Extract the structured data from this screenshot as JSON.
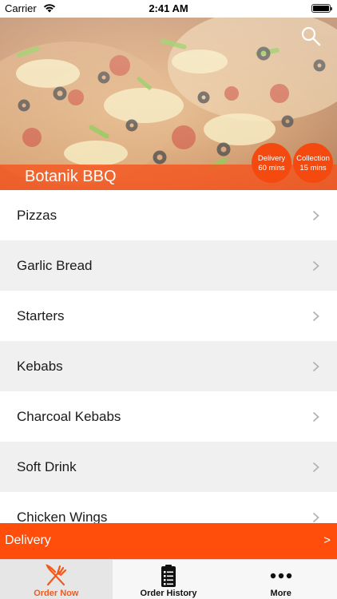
{
  "status_bar": {
    "carrier": "Carrier",
    "time": "2:41 AM"
  },
  "hero": {
    "restaurant_name": "Botanik BBQ",
    "delivery_badge": {
      "label": "Delivery",
      "time": "60 mins"
    },
    "collection_badge": {
      "label": "Collection",
      "time": "15 mins"
    },
    "search_icon": "search-icon"
  },
  "menu": {
    "items": [
      {
        "label": "Pizzas"
      },
      {
        "label": "Garlic Bread"
      },
      {
        "label": "Starters"
      },
      {
        "label": "Kebabs"
      },
      {
        "label": "Charcoal Kebabs"
      },
      {
        "label": "Soft Drink"
      },
      {
        "label": "Chicken Wings"
      }
    ]
  },
  "delivery_bar": {
    "label": "Delivery",
    "arrow": ">"
  },
  "tabs": [
    {
      "label": "Order Now",
      "icon": "fork-knife-icon",
      "active": true
    },
    {
      "label": "Order History",
      "icon": "receipt-icon",
      "active": false
    },
    {
      "label": "More",
      "icon": "more-dots-icon",
      "active": false
    }
  ],
  "colors": {
    "accent": "#ff4e0c",
    "active_tab_text": "#f05a1e"
  }
}
